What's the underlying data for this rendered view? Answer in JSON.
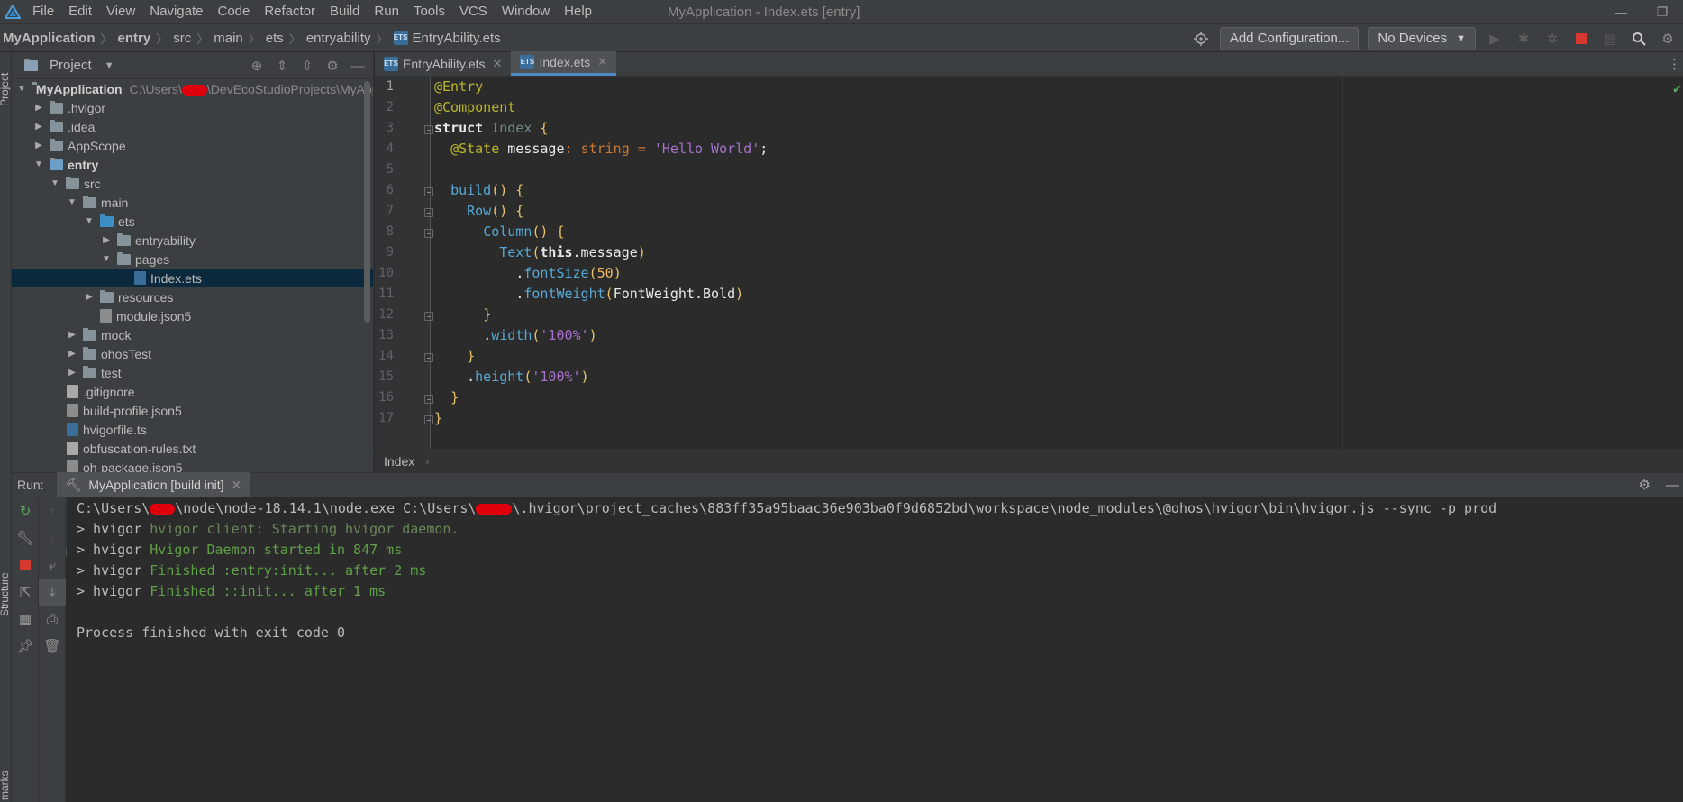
{
  "menu": {
    "items": [
      "File",
      "Edit",
      "View",
      "Navigate",
      "Code",
      "Refactor",
      "Build",
      "Run",
      "Tools",
      "VCS",
      "Window",
      "Help"
    ],
    "window_title": "MyApplication - Index.ets [entry]"
  },
  "breadcrumb": {
    "items": [
      "MyApplication",
      "entry",
      "src",
      "main",
      "ets",
      "entryability",
      "EntryAbility.ets"
    ]
  },
  "toolbar": {
    "add_config_label": "Add Configuration...",
    "devices_label": "No Devices"
  },
  "project_panel": {
    "title": "Project",
    "root_label": "MyApplication",
    "root_path_prefix": "C:\\Users\\",
    "root_path_suffix": "\\DevEcoStudioProjects\\MyApplic",
    "tree": [
      {
        "label": ".hvigor"
      },
      {
        "label": ".idea"
      },
      {
        "label": "AppScope"
      },
      {
        "label": "entry"
      },
      {
        "label": "src"
      },
      {
        "label": "main"
      },
      {
        "label": "ets"
      },
      {
        "label": "entryability"
      },
      {
        "label": "pages"
      },
      {
        "label": "Index.ets"
      },
      {
        "label": "resources"
      },
      {
        "label": "module.json5"
      },
      {
        "label": "mock"
      },
      {
        "label": "ohosTest"
      },
      {
        "label": "test"
      },
      {
        "label": ".gitignore"
      },
      {
        "label": "build-profile.json5"
      },
      {
        "label": "hvigorfile.ts"
      },
      {
        "label": "obfuscation-rules.txt"
      },
      {
        "label": "oh-package.json5"
      }
    ]
  },
  "editor": {
    "tabs": [
      "EntryAbility.ets",
      "Index.ets"
    ],
    "active_tab": "Index.ets",
    "line_numbers": [
      "1",
      "2",
      "3",
      "4",
      "5",
      "6",
      "7",
      "8",
      "9",
      "10",
      "11",
      "12",
      "13",
      "14",
      "15",
      "16",
      "17"
    ],
    "footer_label": "Index"
  },
  "run_panel": {
    "label": "Run:",
    "tab_label": "MyApplication [build init]",
    "command_prefix": "C:\\Users\\",
    "command_middle": "\\node\\node-18.14.1\\node.exe C:\\Users\\",
    "command_suffix": "\\.hvigor\\project_caches\\883ff35a95baac36e903ba0f9d6852bd\\workspace\\node_modules\\@ohos\\hvigor\\bin\\hvigor.js --sync -p prod",
    "lines": [
      {
        "tag": "> hvigor ",
        "msg": "hvigor client: Starting hvigor daemon."
      },
      {
        "tag": "> hvigor ",
        "msg": "Hvigor Daemon started in 847 ms"
      },
      {
        "tag": "> hvigor ",
        "msg": "Finished :entry:init... after 2 ms"
      },
      {
        "tag": "> hvigor ",
        "msg": "Finished ::init... after 1 ms"
      }
    ],
    "exit_message": "Process finished with exit code 0"
  },
  "side_labels": {
    "project": "Project",
    "structure": "Structure",
    "bookmarks": "marks"
  }
}
